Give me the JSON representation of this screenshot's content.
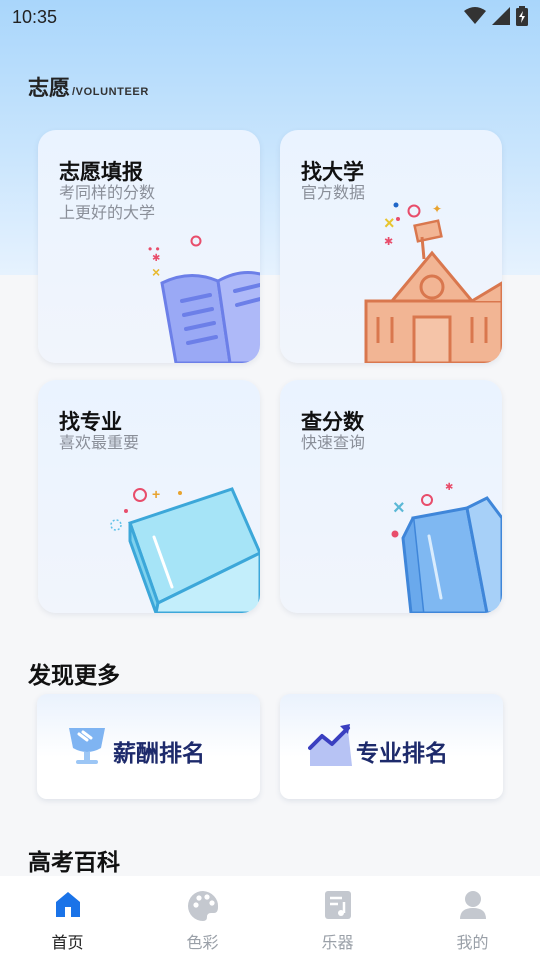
{
  "status_bar": {
    "time": "10:35"
  },
  "header": {
    "title_cn": "志愿",
    "title_en": "/VOLUNTEER"
  },
  "cards": [
    {
      "title": "志愿填报",
      "subtitle": "考同样的分数\n上更好的大学",
      "icon": "open-book-pencil-icon"
    },
    {
      "title": "找大学",
      "subtitle": "官方数据",
      "icon": "university-building-icon"
    },
    {
      "title": "找专业",
      "subtitle": "喜欢最重要",
      "icon": "closed-book-icon"
    },
    {
      "title": "查分数",
      "subtitle": "快速查询",
      "icon": "open-folder-book-icon"
    }
  ],
  "discover": {
    "title": "发现更多",
    "items": [
      {
        "label": "薪酬排名",
        "icon": "trophy-icon"
      },
      {
        "label": "专业排名",
        "icon": "trend-chart-icon"
      }
    ]
  },
  "encyclopedia": {
    "title": "高考百科"
  },
  "tabbar": {
    "tabs": [
      {
        "label": "首页",
        "icon": "home-icon",
        "active": true
      },
      {
        "label": "色彩",
        "icon": "palette-icon",
        "active": false
      },
      {
        "label": "乐器",
        "icon": "music-sheet-icon",
        "active": false
      },
      {
        "label": "我的",
        "icon": "user-icon",
        "active": false
      }
    ],
    "active_color": "#1a73e8",
    "inactive_color": "#c4c8cf"
  }
}
